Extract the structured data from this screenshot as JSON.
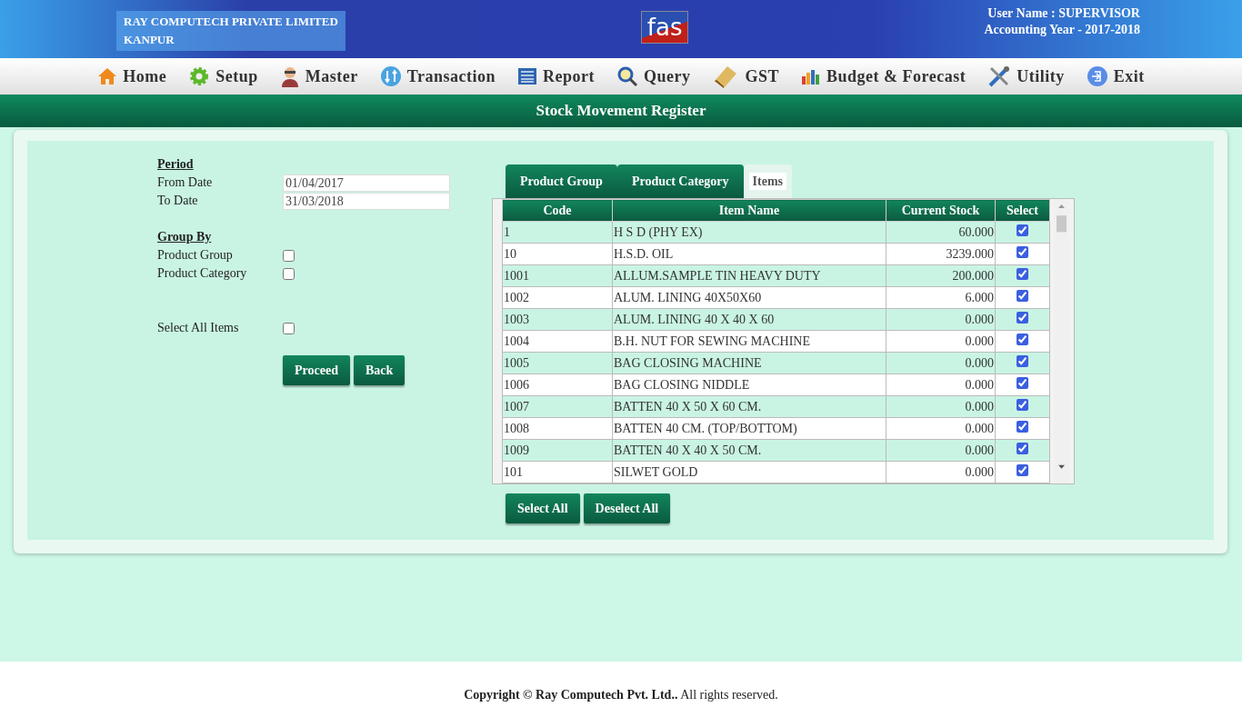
{
  "header": {
    "company": "RAY COMPUTECH PRIVATE LIMITED",
    "city": "KANPUR",
    "logo": "fas",
    "user": "User Name : SUPERVISOR",
    "year": "Accounting Year - 2017-2018"
  },
  "menu": [
    {
      "label": "Home",
      "kind": "home"
    },
    {
      "label": "Setup",
      "kind": "gear"
    },
    {
      "label": "Master",
      "kind": "person"
    },
    {
      "label": "Transaction",
      "kind": "transfer"
    },
    {
      "label": "Report",
      "kind": "report"
    },
    {
      "label": "Query",
      "kind": "search"
    },
    {
      "label": "GST",
      "kind": "book"
    },
    {
      "label": "Budget & Forecast",
      "kind": "chart"
    },
    {
      "label": "Utility",
      "kind": "tools"
    },
    {
      "label": "Exit",
      "kind": "exit"
    }
  ],
  "page_title": "Stock Movement Register",
  "form": {
    "period_heading": "Period",
    "from_label": "From Date",
    "from_value": "01/04/2017",
    "to_label": "To Date",
    "to_value": "31/03/2018",
    "group_heading": "Group By",
    "group_options": [
      {
        "label": "Product Group",
        "checked": false
      },
      {
        "label": "Product Category",
        "checked": false
      }
    ],
    "select_all": {
      "label": "Select All Items",
      "checked": false
    },
    "buttons": [
      "Proceed",
      "Back"
    ]
  },
  "tabs": [
    {
      "label": "Product Group",
      "selected": false
    },
    {
      "label": "Product Category",
      "selected": false
    },
    {
      "label": "Items",
      "selected": true
    }
  ],
  "table": {
    "columns": [
      "Code",
      "Item Name",
      "Current Stock",
      "Select"
    ],
    "rows": [
      {
        "code": "1",
        "name": "H S D (PHY EX)",
        "stock": "60.000",
        "checked": true
      },
      {
        "code": "10",
        "name": "H.S.D. OIL",
        "stock": "3239.000",
        "checked": true
      },
      {
        "code": "1001",
        "name": "ALLUM.SAMPLE TIN HEAVY DUTY",
        "stock": "200.000",
        "checked": true
      },
      {
        "code": "1002",
        "name": "ALUM. LINING 40X50X60",
        "stock": "6.000",
        "checked": true
      },
      {
        "code": "1003",
        "name": "ALUM. LINING 40 X 40 X 60",
        "stock": "0.000",
        "checked": true
      },
      {
        "code": "1004",
        "name": "B.H. NUT FOR SEWING MACHINE",
        "stock": "0.000",
        "checked": true
      },
      {
        "code": "1005",
        "name": "BAG CLOSING MACHINE",
        "stock": "0.000",
        "checked": true
      },
      {
        "code": "1006",
        "name": "BAG CLOSING NIDDLE",
        "stock": "0.000",
        "checked": true
      },
      {
        "code": "1007",
        "name": "BATTEN 40 X 50 X 60 CM.",
        "stock": "0.000",
        "checked": true
      },
      {
        "code": "1008",
        "name": "BATTEN 40 CM. (TOP/BOTTOM)",
        "stock": "0.000",
        "checked": true
      },
      {
        "code": "1009",
        "name": "BATTEN 40 X 40 X 50 CM.",
        "stock": "0.000",
        "checked": true
      },
      {
        "code": "101",
        "name": "SILWET GOLD",
        "stock": "0.000",
        "checked": true
      }
    ]
  },
  "table_buttons": [
    "Select All",
    "Deselect All"
  ],
  "footer": "**Copyright © Ray Computech Pvt. Ltd..** All rights reserved."
}
